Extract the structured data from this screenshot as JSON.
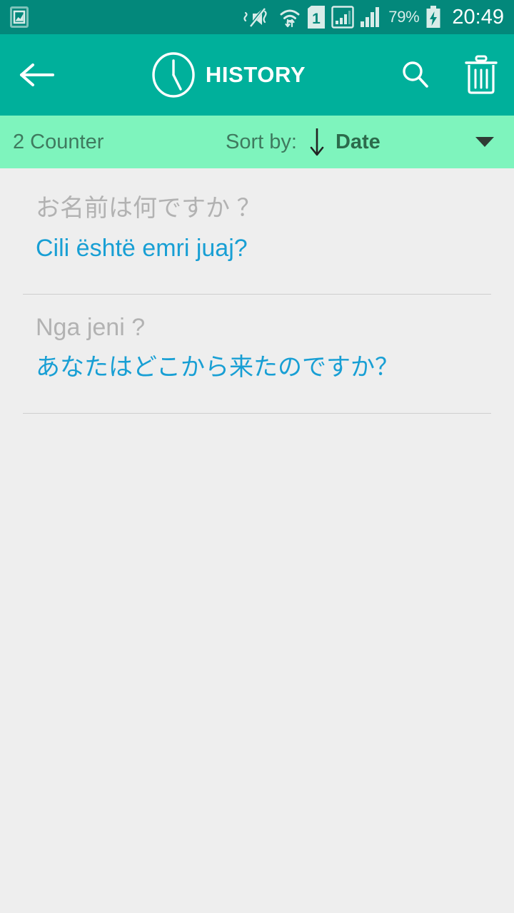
{
  "statusbar": {
    "icons": [
      {
        "name": "screenshot-icon",
        "label": "screenshot-saved"
      },
      {
        "name": "mute-vibrate-icon",
        "label": "sound-off-vibrate"
      },
      {
        "name": "wifi-icon",
        "label": "wifi-data-transfer"
      },
      {
        "name": "sim-card-icon",
        "label": "1"
      },
      {
        "name": "signal-boxed-icon",
        "label": "mobile-signal-1"
      },
      {
        "name": "signal-bars-icon",
        "label": "mobile-signal-2"
      }
    ],
    "battery_percent": "79%",
    "battery_charging": true,
    "clock": "20:49",
    "background": "#03887b"
  },
  "appbar": {
    "background": "#00b09b",
    "back_label": "back-arrow",
    "clock_icon": "clock-icon",
    "title": "HISTORY",
    "search_label": "search-icon",
    "delete_label": "delete-icon"
  },
  "sortbar": {
    "background": "#7ef4bd",
    "counter": "2 Counter",
    "sort_label": "Sort by:",
    "sort_direction": "descending",
    "sort_value": "Date",
    "dropdown_icon": "chevron-down-icon"
  },
  "list": {
    "background": "#eeeeee",
    "source_color": "#b2b2b2",
    "target_color": "#189fd4",
    "items": [
      {
        "source": "お名前は何ですか ？",
        "target": "Cili është emri juaj?"
      },
      {
        "source": "Nga jeni ?",
        "target": "あなたはどこから来たのですか？"
      }
    ]
  }
}
